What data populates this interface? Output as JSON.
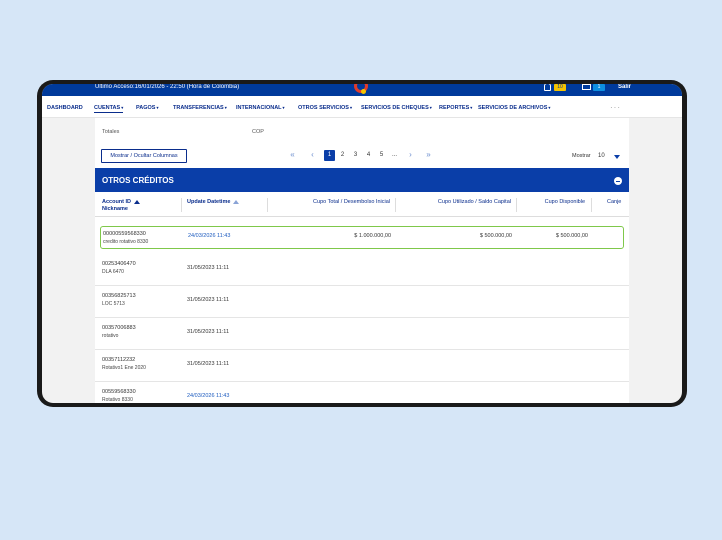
{
  "header": {
    "last_access": "Ultimo Acceso:16/01/2026 - 22:50 (Hora de Colombia)",
    "notifications_count": "10",
    "messages_count": "1",
    "logout_label": "Salir"
  },
  "nav": {
    "items": [
      {
        "label": "DASHBOARD"
      },
      {
        "label": "CUENTAS"
      },
      {
        "label": "PAGOS"
      },
      {
        "label": "TRANSFERENCIAS"
      },
      {
        "label": "INTERNACIONAL"
      },
      {
        "label": "OTROS SERVICIOS"
      },
      {
        "label": "SERVICIOS DE CHEQUES"
      },
      {
        "label": "REPORTES"
      },
      {
        "label": "SERVICIOS DE ARCHIVOS"
      }
    ],
    "active": "CUENTAS",
    "more_icon": "ellipsis-icon"
  },
  "summary": {
    "totales_label": "Totales",
    "currency": "COP"
  },
  "toolbar": {
    "columns_button": "Mostrar / Ocultar Columnas",
    "pages": [
      "1",
      "2",
      "3",
      "4",
      "5",
      "..."
    ],
    "current_page": "1",
    "show_label": "Mostrar",
    "page_size": "10"
  },
  "section": {
    "title": "OTROS CRÉDITOS"
  },
  "table": {
    "headers": {
      "account_id": "Account ID",
      "nickname": "Nickname",
      "update_datetime": "Update Datetime",
      "cupo_total": "Cupo Total / Desembolso Inicial",
      "cupo_utilizado": "Cupo Utilizado / Saldo Capital",
      "cupo_disponible": "Cupo Disponible",
      "canje": "Canje"
    },
    "rows": [
      {
        "account_id": "00000559568330",
        "nickname": "credito rotativo 8330",
        "update": "24/03/2026 11:43",
        "cupo_total": "$ 1.000.000,00",
        "cupo_utilizado": "$ 500.000,00",
        "cupo_disponible": "$ 500.000,00"
      },
      {
        "account_id": "00253406470",
        "nickname": "DLA 6470",
        "update": "31/05/2023 11:11",
        "cupo_total": "",
        "cupo_utilizado": "",
        "cupo_disponible": ""
      },
      {
        "account_id": "00356825713",
        "nickname": "LOC 5713",
        "update": "31/05/2023 11:11",
        "cupo_total": "",
        "cupo_utilizado": "",
        "cupo_disponible": ""
      },
      {
        "account_id": "00357006883",
        "nickname": "rotativo",
        "update": "31/05/2023 11:11",
        "cupo_total": "",
        "cupo_utilizado": "",
        "cupo_disponible": ""
      },
      {
        "account_id": "00357112232",
        "nickname": "Rotativo1 Ene 2020",
        "update": "31/05/2023 11:11",
        "cupo_total": "",
        "cupo_utilizado": "",
        "cupo_disponible": ""
      },
      {
        "account_id": "00559568330",
        "nickname": "Rotativo 8330",
        "update": "24/03/2026 11:43",
        "cupo_total": "",
        "cupo_utilizado": "",
        "cupo_disponible": ""
      }
    ]
  },
  "colors": {
    "brand_blue": "#003a9b",
    "section_blue": "#0a3ea8",
    "selected_border": "#7fc84a",
    "background": "#d6e6f7"
  }
}
